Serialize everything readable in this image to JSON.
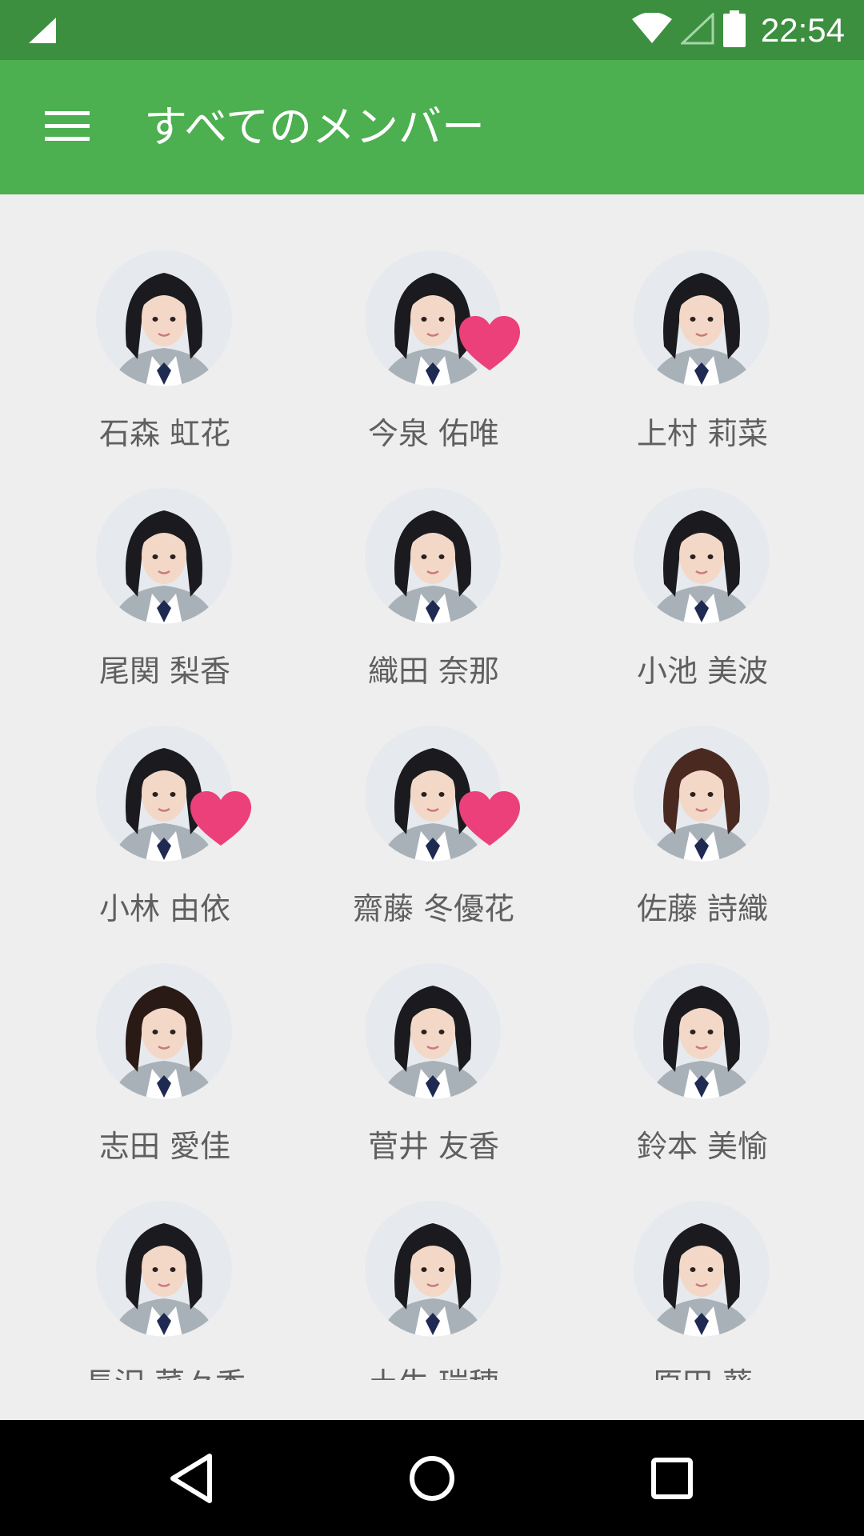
{
  "status_bar": {
    "time": "22:54",
    "signal_icon": "cell-signal-icon",
    "wifi_icon": "wifi-icon",
    "battery_icon": "battery-icon"
  },
  "app_bar": {
    "title": "すべてのメンバー",
    "menu_icon": "hamburger-menu-icon"
  },
  "colors": {
    "status_bar": "#3c8f3f",
    "app_bar": "#4caf50",
    "background": "#eeeeee",
    "heart": "#ec407a",
    "name_text": "#5f5f5f"
  },
  "members": [
    {
      "name": "石森 虹花",
      "favorite": false,
      "hair": "#1b1b1f"
    },
    {
      "name": "今泉 佑唯",
      "favorite": true,
      "hair": "#1b1b1f"
    },
    {
      "name": "上村 莉菜",
      "favorite": false,
      "hair": "#1b1b1f"
    },
    {
      "name": "尾関 梨香",
      "favorite": false,
      "hair": "#1b1b1f"
    },
    {
      "name": "織田 奈那",
      "favorite": false,
      "hair": "#1b1b1f"
    },
    {
      "name": "小池 美波",
      "favorite": false,
      "hair": "#1b1b1f"
    },
    {
      "name": "小林 由依",
      "favorite": true,
      "hair": "#1b1b1f"
    },
    {
      "name": "齋藤 冬優花",
      "favorite": true,
      "hair": "#1b1b1f"
    },
    {
      "name": "佐藤 詩織",
      "favorite": false,
      "hair": "#4a2a20"
    },
    {
      "name": "志田 愛佳",
      "favorite": false,
      "hair": "#2a1a16"
    },
    {
      "name": "菅井 友香",
      "favorite": false,
      "hair": "#1b1b1f"
    },
    {
      "name": "鈴本 美愉",
      "favorite": false,
      "hair": "#1b1b1f"
    },
    {
      "name": "長沢 菜々香",
      "favorite": false,
      "hair": "#1b1b1f"
    },
    {
      "name": "土生 瑞穂",
      "favorite": false,
      "hair": "#1b1b1f"
    },
    {
      "name": "原田 葵",
      "favorite": false,
      "hair": "#1b1b1f"
    }
  ],
  "nav_bar": {
    "back_icon": "back-triangle-icon",
    "home_icon": "home-circle-icon",
    "recents_icon": "recents-square-icon"
  }
}
